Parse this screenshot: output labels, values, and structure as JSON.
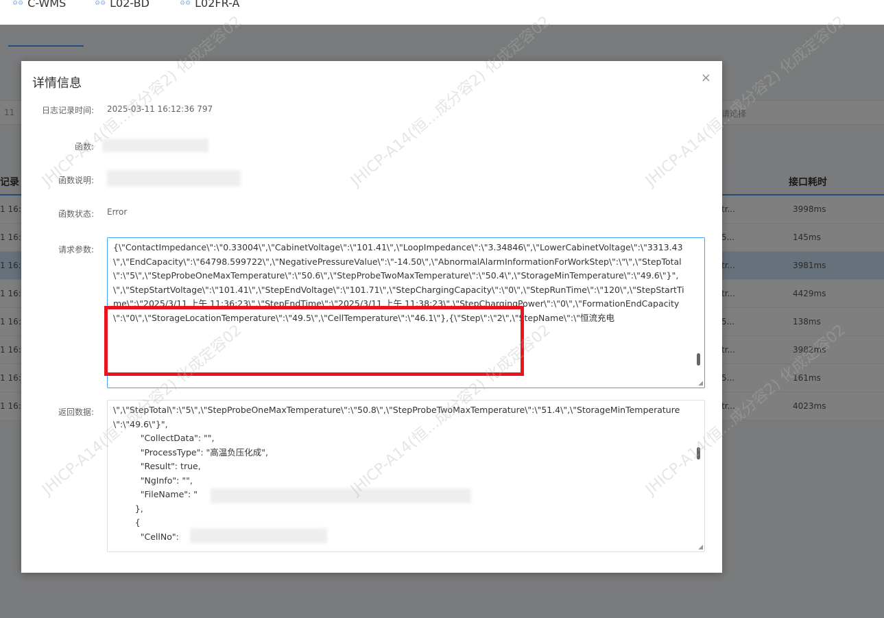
{
  "breadcrumbs": [
    {
      "icon": "project-icon",
      "label": "C-WMS"
    },
    {
      "icon": "project-icon",
      "label": "L02-BD"
    },
    {
      "icon": "project-icon",
      "label": "L02FR-A"
    }
  ],
  "background": {
    "left_fragment": "11",
    "select_placeholder": "请选择",
    "table_headers": {
      "left": "记录",
      "right": "接口耗时"
    },
    "rows": [
      {
        "time": "1 16:",
        "type": "tr...",
        "duration": "3998ms",
        "selected": false
      },
      {
        "time": "1 16:",
        "type": "5...",
        "duration": "145ms",
        "selected": false
      },
      {
        "time": "1 16:",
        "type": "tr...",
        "duration": "3981ms",
        "selected": true
      },
      {
        "time": "1 16:",
        "type": "tr...",
        "duration": "4429ms",
        "selected": false
      },
      {
        "time": "1 16:",
        "type": "5...",
        "duration": "138ms",
        "selected": false
      },
      {
        "time": "1 16:",
        "type": "tr...",
        "duration": "3982ms",
        "selected": false
      },
      {
        "time": "1 16:",
        "type": "5...",
        "duration": "161ms",
        "selected": false
      },
      {
        "time": "1 16:",
        "type": "tr...",
        "duration": "4023ms",
        "selected": false
      }
    ]
  },
  "dialog": {
    "title": "详情信息",
    "close_symbol": "×",
    "fields": {
      "log_time_label": "日志记录时间:",
      "log_time_value": "2025-03-11 16:12:36 797",
      "function_label": "函数:",
      "function_desc_label": "函数说明:",
      "function_status_label": "函数状态:",
      "function_status_value": "Error",
      "request_label": "请求参数:",
      "response_label": "返回数据:"
    },
    "request_text": "{\\\"ContactImpedance\\\":\\\"0.33004\\\",\\\"CabinetVoltage\\\":\\\"101.41\\\",\\\"LoopImpedance\\\":\\\"3.34846\\\",\\\"LowerCabinetVoltage\\\":\\\"3313.43\\\",\\\"EndCapacity\\\":\\\"64798.599722\\\",\\\"NegativePressureValue\\\":\\\"-14.50\\\",\\\"AbnormalAlarmInformationForWorkStep\\\":\\\"\\\",\\\"StepTotal\\\":\\\"5\\\",\\\"StepProbeOneMaxTemperature\\\":\\\"50.6\\\",\\\"StepProbeTwoMaxTemperature\\\":\\\"50.4\\\",\\\"StorageMinTemperature\\\":\\\"49.6\\\"}\",\n\\\",\\\"StepStartVoltage\\\":\\\"101.41\\\",\\\"StepEndVoltage\\\":\\\"101.71\\\",\\\"StepChargingCapacity\\\":\\\"0\\\",\\\"StepRunTime\\\":\\\"120\\\",\\\"StepStartTime\\\":\\\"2025/3/11 上午 11:36:23\\\",\\\"StepEndTime\\\":\\\"2025/3/11 上午 11:38:23\\\",\\\"StepChargingPower\\\":\\\"0\\\",\\\"FormationEndCapacity\\\":\\\"0\\\",\\\"StorageLocationTemperature\\\":\\\"49.5\\\",\\\"CellTemperature\\\":\\\"46.1\\\"},{\\\"Step\\\":\\\"2\\\",\\\"StepName\\\":\\\"恒流充电",
    "response_text": "\\\",\\\"StepTotal\\\":\\\"5\\\",\\\"StepProbeOneMaxTemperature\\\":\\\"50.8\\\",\\\"StepProbeTwoMaxTemperature\\\":\\\"51.4\\\",\\\"StorageMinTemperature\\\":\\\"49.6\\\"}\",\n          \"CollectData\": \"\",\n          \"ProcessType\": \"高温负压化成\",\n          \"Result\": true,\n          \"NgInfo\": \"\",\n          \"FileName\": \"\n        },\n        {\n          \"CellNo\": "
  },
  "colors": {
    "highlight_box": "#e8141e",
    "accent": "#409eff",
    "selected_row": "#cfe3f7"
  },
  "watermark": "JHICP-A14(恒...成分容2) 化成定容02"
}
